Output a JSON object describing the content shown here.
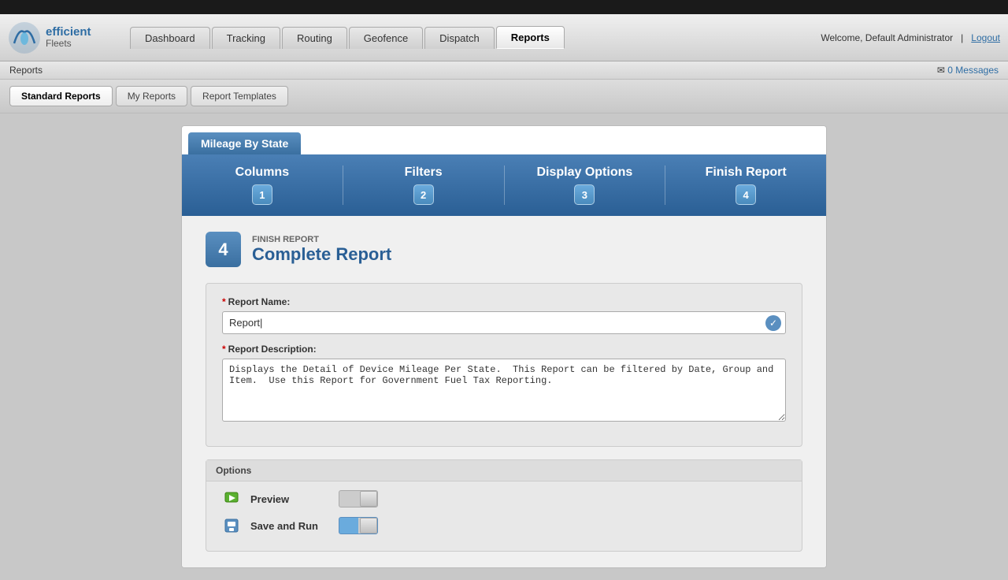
{
  "topbar": {},
  "header": {
    "logo": {
      "efficient": "efficient",
      "fleets": "Fleets"
    },
    "nav": [
      {
        "label": "Dashboard",
        "active": false
      },
      {
        "label": "Tracking",
        "active": false
      },
      {
        "label": "Routing",
        "active": false
      },
      {
        "label": "Geofence",
        "active": false
      },
      {
        "label": "Dispatch",
        "active": false
      },
      {
        "label": "Reports",
        "active": true
      }
    ],
    "welcome_text": "Welcome,  Default Administrator",
    "logout_label": "Logout",
    "messages_label": "0 Messages"
  },
  "breadcrumb": {
    "current": "Reports"
  },
  "sub_nav": {
    "tabs": [
      {
        "label": "Standard Reports",
        "active": true
      },
      {
        "label": "My Reports",
        "active": false
      },
      {
        "label": "Report Templates",
        "active": false
      }
    ]
  },
  "report": {
    "title": "Mileage By State",
    "steps": [
      {
        "label": "Columns",
        "number": "1"
      },
      {
        "label": "Filters",
        "number": "2"
      },
      {
        "label": "Display Options",
        "number": "3"
      },
      {
        "label": "Finish Report",
        "number": "4"
      }
    ],
    "step_current_subtitle": "FINISH REPORT",
    "step_current_title": "Complete Report",
    "step_current_number": "4",
    "fields": {
      "report_name_label": "Report Name:",
      "report_name_value": "Report|",
      "report_description_label": "Report Description:",
      "report_description_value": "Displays the Detail of Device Mileage Per State.  This Report can be filtered by Date, Group and Item.  Use this Report for Government Fuel Tax Reporting."
    },
    "options": {
      "header": "Options",
      "items": [
        {
          "label": "Preview",
          "toggle_on": false
        },
        {
          "label": "Save and Run",
          "toggle_on": true
        }
      ]
    }
  }
}
